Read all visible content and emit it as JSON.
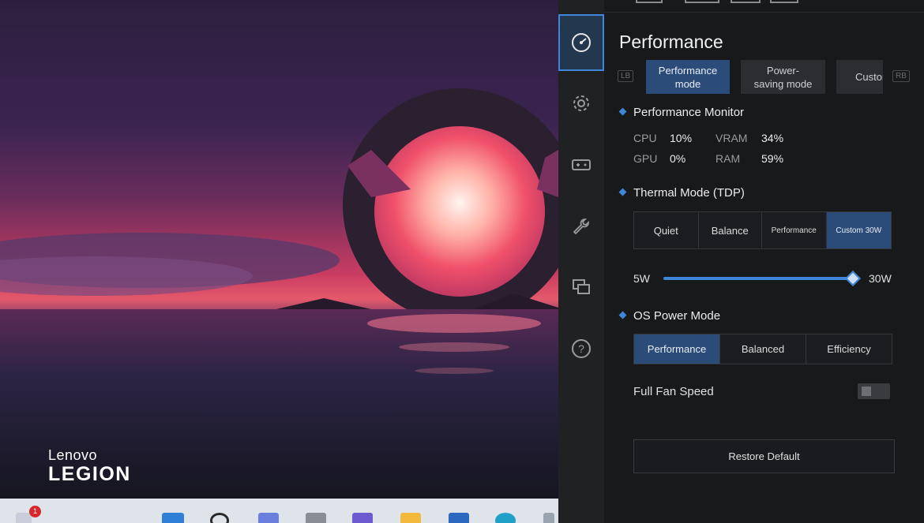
{
  "desktop": {
    "brand_lenovo": "Lenovo",
    "brand_legion": "LEGION",
    "notification_count": "1"
  },
  "panel": {
    "title": "Performance",
    "nav": [
      {
        "name": "performance",
        "icon": "gauge-icon",
        "active": true
      },
      {
        "name": "settings",
        "icon": "gear-icon",
        "active": false
      },
      {
        "name": "controller",
        "icon": "gamepad-icon",
        "active": false
      },
      {
        "name": "tools",
        "icon": "wrench-icon",
        "active": false
      },
      {
        "name": "display",
        "icon": "monitor-icon",
        "active": false
      },
      {
        "name": "help",
        "icon": "help-icon",
        "active": false
      }
    ],
    "bumpers": {
      "left": "LB",
      "right": "RB"
    },
    "modes": [
      {
        "label": "Performance mode",
        "active": true
      },
      {
        "label": "Power-saving mode",
        "active": false
      },
      {
        "label": "Custom",
        "active": false
      }
    ],
    "monitor": {
      "title": "Performance Monitor",
      "cpu_label": "CPU",
      "cpu_value": "10%",
      "vram_label": "VRAM",
      "vram_value": "34%",
      "gpu_label": "GPU",
      "gpu_value": "0%",
      "ram_label": "RAM",
      "ram_value": "59%"
    },
    "thermal": {
      "title": "Thermal Mode (TDP)",
      "options": [
        {
          "label": "Quiet",
          "active": false
        },
        {
          "label": "Balance",
          "active": false
        },
        {
          "label": "Performance",
          "active": false
        },
        {
          "label": "Custom 30W",
          "active": true
        }
      ],
      "slider_min": "5W",
      "slider_max": "30W",
      "slider_fraction": 1.0
    },
    "os_power": {
      "title": "OS Power Mode",
      "options": [
        {
          "label": "Performance",
          "active": true
        },
        {
          "label": "Balanced",
          "active": false
        },
        {
          "label": "Efficiency",
          "active": false
        }
      ]
    },
    "fan": {
      "label": "Full Fan Speed",
      "on": false
    },
    "restore_label": "Restore Default"
  },
  "colors": {
    "accent": "#3f86d8",
    "active_button": "#2b4b78",
    "panel_bg": "#18191b"
  }
}
